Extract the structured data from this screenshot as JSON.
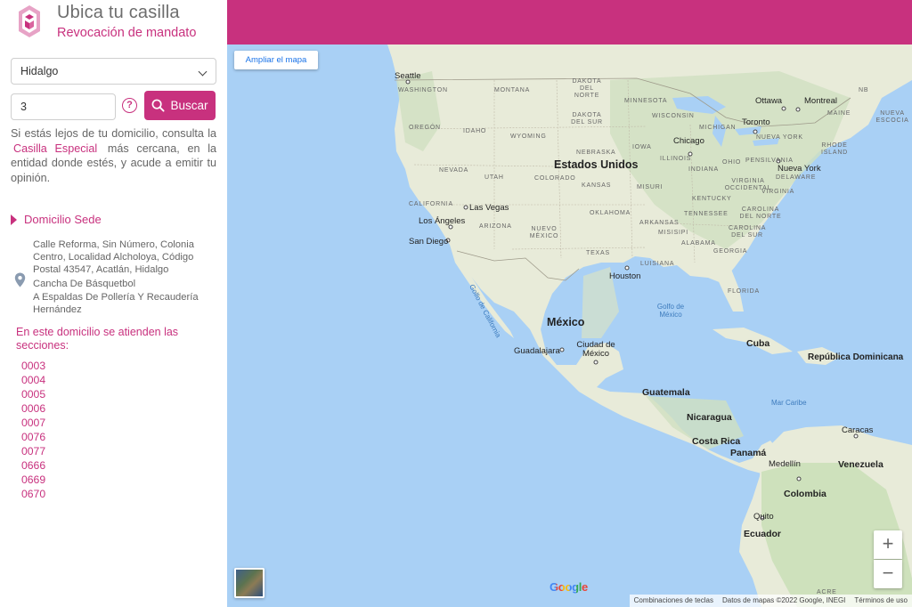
{
  "app": {
    "title": "Ubica tu casilla",
    "subtitle": "Revocación de mandato",
    "brand_color": "#c8317e"
  },
  "form": {
    "state_value": "Hidalgo",
    "section_value": "3",
    "search_label": "Buscar",
    "help_icon": "question-circle-icon",
    "search_icon": "search-icon"
  },
  "info": {
    "before_link": "Si estás lejos de tu domicilio, consulta la",
    "link_label": "Casilla Especial",
    "after_link": "más cercana, en la entidad donde estés, y acude a emitir tu opinión."
  },
  "sede": {
    "header": "Domicilio Sede",
    "address_line": "Calle Reforma, Sin Número, Colonia Centro, Localidad Alcholoya, Código Postal 43547, Acatlán, Hidalgo",
    "place_name": "Cancha De Básquetbol",
    "reference": "A Espaldas De Pollería Y Recaudería Hernández",
    "sections_title": "En este domicilio se atienden las secciones:",
    "sections": [
      "0003",
      "0004",
      "0005",
      "0006",
      "0007",
      "0076",
      "0077",
      "0666",
      "0669",
      "0670"
    ]
  },
  "map": {
    "expand_label": "Ampliar el mapa",
    "zoom_in": "+",
    "zoom_out": "−",
    "google_logo": "Google",
    "footer_shortcuts": "Combinaciones de teclas",
    "footer_data": "Datos de mapas ©2022 Google, INEGI",
    "footer_terms": "Términos de uso",
    "countries": {
      "usa": "Estados Unidos",
      "mexico": "México",
      "cuba": "Cuba",
      "dominicana": "República Dominicana",
      "guatemala": "Guatemala",
      "nicaragua": "Nicaragua",
      "costa_rica": "Costa Rica",
      "panama": "Panamá",
      "venezuela": "Venezuela",
      "colombia": "Colombia",
      "ecuador": "Ecuador"
    },
    "cities": {
      "seattle": "Seattle",
      "chicago": "Chicago",
      "toronto": "Toronto",
      "ottawa": "Ottawa",
      "montreal": "Montreal",
      "new_york": "Nueva York",
      "las_vegas": "Las Vegas",
      "los_angeles": "Los Ángeles",
      "san_diego": "San Diego",
      "houston": "Houston",
      "guadalajara": "Guadalajara",
      "ciudad_mexico": "Ciudad de México",
      "caracas": "Caracas",
      "medellin": "Medellín",
      "quito": "Quito"
    },
    "states": {
      "washington": "WASHINGTON",
      "montana": "MONTANA",
      "north_dakota": "DAKOTA DEL NORTE",
      "minnesota": "MINNESOTA",
      "south_dakota": "DAKOTA DEL SUR",
      "wisconsin": "WISCONSIN",
      "michigan": "MICHIGAN",
      "oregon": "OREGÓN",
      "idaho": "IDAHO",
      "wyoming": "WYOMING",
      "nebraska": "NEBRASKA",
      "iowa": "IOWA",
      "nevada": "NEVADA",
      "utah": "UTAH",
      "illinois": "ILLINOIS",
      "indiana": "INDIANA",
      "ohio": "OHIO",
      "pennsylvania": "PENSILVANIA",
      "california": "CALIFORNIA",
      "colorado": "COLORADO",
      "kansas": "KANSAS",
      "missouri": "MISURI",
      "west_virginia": "VIRGINIA OCCIDENTAL",
      "virginia": "VIRGINIA",
      "kentucky": "KENTUCKY",
      "arizona": "ARIZONA",
      "new_mexico": "NUEVO MÉXICO",
      "oklahoma": "OKLAHOMA",
      "tennessee": "TENNESSEE",
      "north_carolina": "CAROLINA DEL NORTE",
      "arkansas": "ARKANSAS",
      "south_carolina": "CAROLINA DEL SUR",
      "mississippi": "MISISIPI",
      "alabama": "ALABAMA",
      "georgia": "GEORGIA",
      "texas": "TEXAS",
      "louisiana": "LUISIANA",
      "florida": "FLORIDA",
      "maine": "MAINE",
      "new_york_state": "NUEVA YORK",
      "rhode_island": "RHODE ISLAND",
      "delaware": "DELAWARE",
      "nb": "NB",
      "nova_scotia": "NUEVA ESCOCIA",
      "acre": "ACRE"
    },
    "water": {
      "gulf_california": "Golfo de California",
      "gulf_mexico": "Golfo de México",
      "caribbean": "Mar Caribe"
    }
  }
}
